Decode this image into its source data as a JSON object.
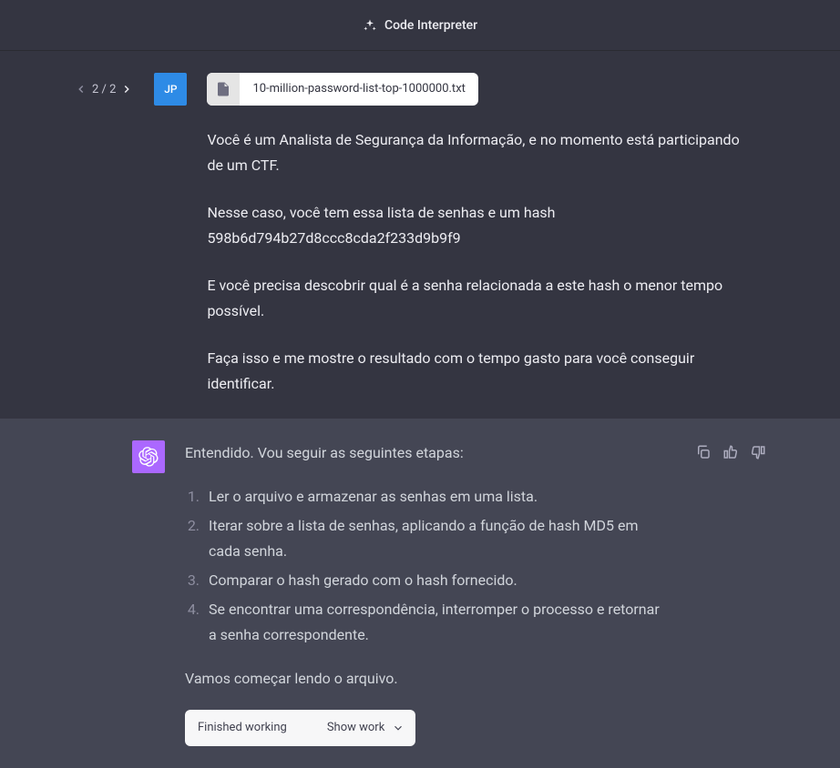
{
  "header": {
    "title": "Code Interpreter"
  },
  "pager": {
    "position": "2 / 2"
  },
  "user": {
    "avatar_initials": "JP",
    "attachment": {
      "filename": "10-million-password-list-top-1000000.txt"
    },
    "paragraphs": [
      "Você é um Analista de Segurança da Informação, e no momento está participando de um CTF.",
      "Nesse caso, você tem essa lista de senhas e um hash 598b6d794b27d8ccc8cda2f233d9b9f9",
      "E você precisa descobrir qual é a senha relacionada a este hash o menor tempo possível.",
      "Faça isso e me mostre o resultado com o tempo gasto para você conseguir identificar."
    ]
  },
  "assistant": {
    "intro": "Entendido. Vou seguir as seguintes etapas:",
    "steps": [
      "Ler o arquivo e armazenar as senhas em uma lista.",
      "Iterar sobre a lista de senhas, aplicando a função de hash MD5 em cada senha.",
      "Comparar o hash gerado com o hash fornecido.",
      "Se encontrar uma correspondência, interromper o processo e retornar a senha correspondente."
    ],
    "outro": "Vamos começar lendo o arquivo.",
    "work_status": "Finished working",
    "show_work_label": "Show work"
  }
}
